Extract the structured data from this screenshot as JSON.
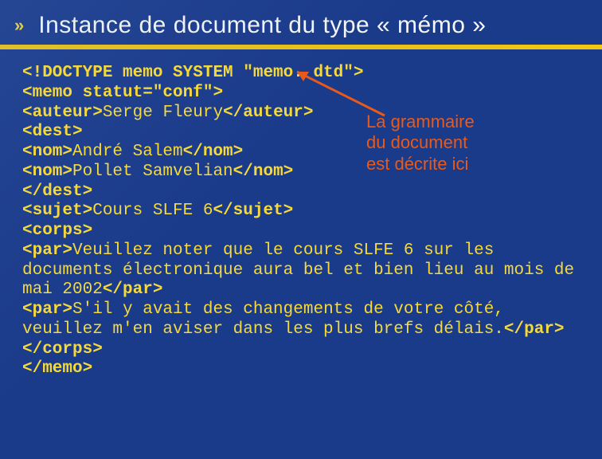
{
  "header": {
    "bullet": "»",
    "title": "Instance de document du type « mémo »"
  },
  "annotation": {
    "line1": "La grammaire",
    "line2": "du document",
    "line3": "est décrite ici"
  },
  "code": {
    "l1_tag": "<!DOCTYPE memo SYSTEM \"memo. dtd\">",
    "l2_tag": "<memo statut=\"conf\">",
    "l3_open": "<auteur>",
    "l3_txt": "Serge Fleury",
    "l3_close": "</auteur>",
    "l4_tag": "<dest>",
    "l5_open": "<nom>",
    "l5_txt": "André Salem",
    "l5_close": "</nom>",
    "l6_open": "<nom>",
    "l6_txt": "Pollet Samvelian",
    "l6_close": "</nom>",
    "l7_tag": "</dest>",
    "l8_open": "<sujet>",
    "l8_txt": "Cours SLFE 6",
    "l8_close": "</sujet>",
    "l9_tag": "<corps>",
    "l10_open": "<par>",
    "l10_txt": "Veuillez noter que le cours SLFE 6 sur les documents électronique aura bel et bien lieu au mois de mai 2002",
    "l10_close": "</par>",
    "l11_open": "<par>",
    "l11_txt": "S'il y avait des changements de votre côté, veuillez m'en aviser dans les plus brefs délais.",
    "l11_close": "</par>",
    "l12_tag": "</corps>",
    "l13_tag": "</memo>"
  }
}
